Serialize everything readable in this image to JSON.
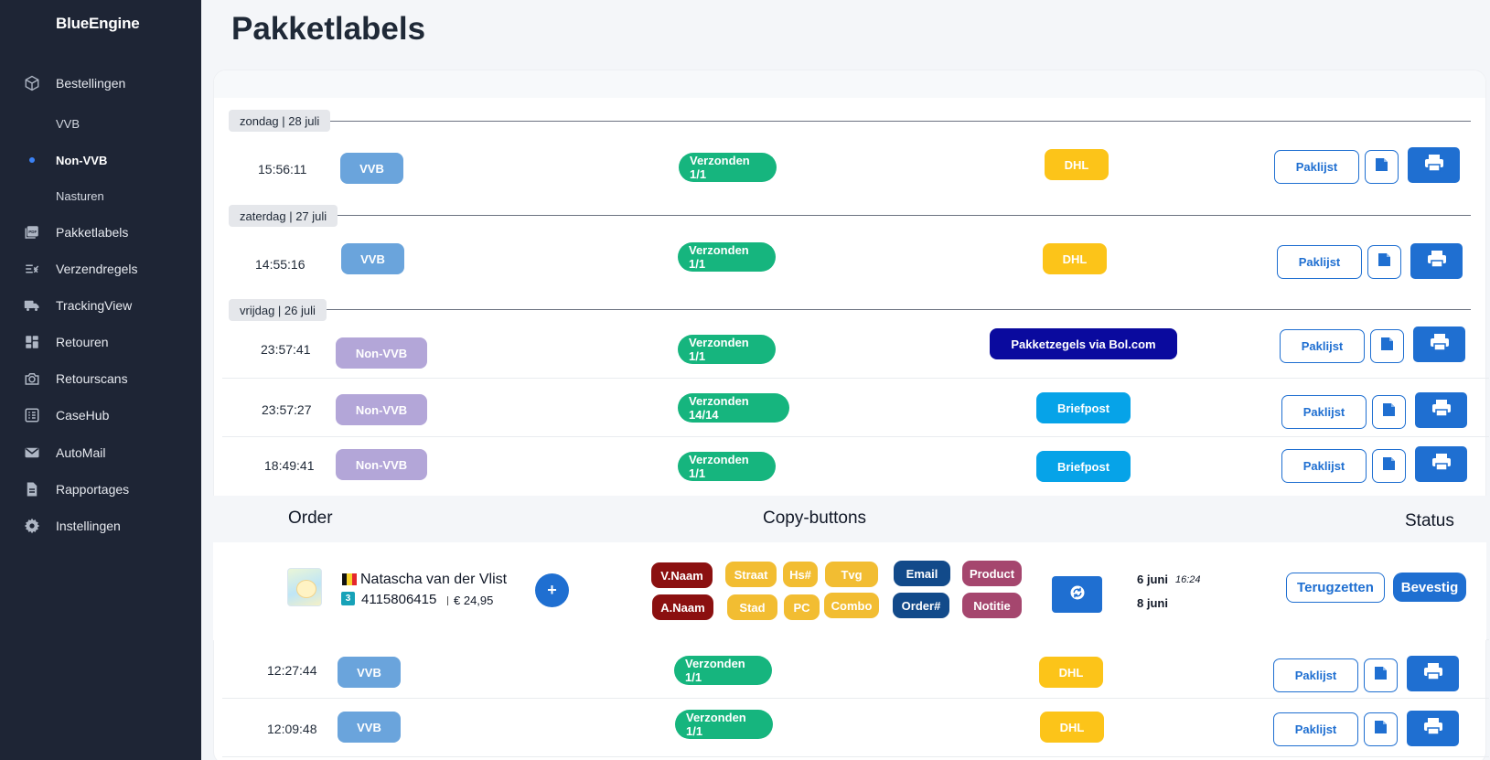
{
  "app": {
    "brand": "BlueEngine"
  },
  "sidebar": {
    "items": [
      {
        "label": "Bestellingen",
        "icon": "box-icon"
      },
      {
        "label": "VVB",
        "icon": ""
      },
      {
        "label": "Non-VVB",
        "icon": "",
        "active": true
      },
      {
        "label": "Nasturen",
        "icon": ""
      },
      {
        "label": "Pakketlabels",
        "icon": "pdf-icon"
      },
      {
        "label": "Verzendregels",
        "icon": "list-check-icon"
      },
      {
        "label": "TrackingView",
        "icon": "truck-icon"
      },
      {
        "label": "Retouren",
        "icon": "grid-icon"
      },
      {
        "label": "Retourscans",
        "icon": "camera-icon"
      },
      {
        "label": "CaseHub",
        "icon": "checklist-icon"
      },
      {
        "label": "AutoMail",
        "icon": "envelope-icon"
      },
      {
        "label": "Rapportages",
        "icon": "document-icon"
      },
      {
        "label": "Instellingen",
        "icon": "gear-icon"
      }
    ]
  },
  "page": {
    "title": "Pakketlabels"
  },
  "dates": [
    "zondag | 28 juli",
    "zaterdag | 27 juli",
    "vrijdag | 26 juli"
  ],
  "rows": [
    {
      "time": "15:56:11",
      "type": "VVB",
      "status": "Verzonden 1/1",
      "carrier": "DHL",
      "paklijst": "Paklijst"
    },
    {
      "time": "14:55:16",
      "type": "VVB",
      "status": "Verzonden 1/1",
      "carrier": "DHL",
      "paklijst": "Paklijst"
    },
    {
      "time": "23:57:41",
      "type": "Non-VVB",
      "status": "Verzonden 1/1",
      "carrier": "Pakketzegels via Bol.com",
      "paklijst": "Paklijst"
    },
    {
      "time": "23:57:27",
      "type": "Non-VVB",
      "status": "Verzonden 14/14",
      "carrier": "Briefpost",
      "paklijst": "Paklijst"
    },
    {
      "time": "18:49:41",
      "type": "Non-VVB",
      "status": "Verzonden 1/1",
      "carrier": "Briefpost",
      "paklijst": "Paklijst"
    },
    {
      "time": "12:27:44",
      "type": "VVB",
      "status": "Verzonden 1/1",
      "carrier": "DHL",
      "paklijst": "Paklijst"
    },
    {
      "time": "12:09:48",
      "type": "VVB",
      "status": "Verzonden 1/1",
      "carrier": "DHL",
      "paklijst": "Paklijst"
    }
  ],
  "detail": {
    "headers": {
      "order": "Order",
      "copy": "Copy-buttons",
      "status": "Status"
    },
    "customer_name": "Natascha van der Vlist",
    "qty": "3",
    "order_number": "4115806415",
    "price": "€ 24,95",
    "plus": "+",
    "copy_buttons": [
      {
        "label": "V.Naam",
        "color": "#8b1010"
      },
      {
        "label": "A.Naam",
        "color": "#8b1010"
      },
      {
        "label": "Straat",
        "color": "#f2bd32"
      },
      {
        "label": "Hs#",
        "color": "#f2bd32"
      },
      {
        "label": "Tvg",
        "color": "#f2bd32"
      },
      {
        "label": "Stad",
        "color": "#f2bd32"
      },
      {
        "label": "PC",
        "color": "#f2bd32"
      },
      {
        "label": "Combo",
        "color": "#f2bd32"
      },
      {
        "label": "Email",
        "color": "#124a8a"
      },
      {
        "label": "Order#",
        "color": "#124a8a"
      },
      {
        "label": "Product",
        "color": "#a5466e"
      },
      {
        "label": "Notitie",
        "color": "#a5466e"
      }
    ],
    "date_1": "6 juni",
    "date_1_time": "16:24",
    "date_2": "8 juni",
    "btn_terug": "Terugzetten",
    "btn_bevestig": "Bevestig"
  },
  "colors": {
    "sidebar_bg": "#1e2535",
    "accent": "#1f6fd1",
    "vvb": "#6aa4dc",
    "non_vvb": "#b3a6d8",
    "status_green": "#16b57e",
    "dhl": "#fcc419",
    "bol": "#0a0a9e",
    "briefpost": "#06a3e8"
  }
}
